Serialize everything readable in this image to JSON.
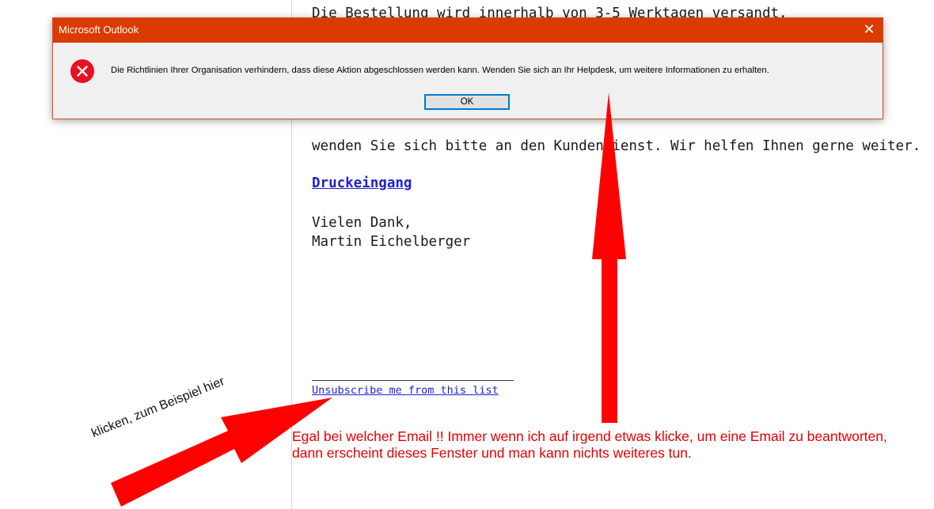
{
  "email": {
    "line_top": "Die Bestellung wird innerhalb von 3-5 Werktagen versandt.",
    "line_contact": "wenden Sie sich bitte an den Kundendienst. Wir helfen Ihnen gerne weiter.",
    "link_label": "Druckeingang",
    "closing": "Vielen Dank,",
    "sender": "Martin Eichelberger",
    "unsubscribe_label": "Unsubscribe me from this list"
  },
  "dialog": {
    "title": "Microsoft Outlook",
    "close_label": "✕",
    "message": "Die Richtlinien Ihrer Organisation verhindern, dass diese Aktion abgeschlossen werden kann. Wenden Sie sich an Ihr Helpdesk, um weitere Informationen zu erhalten.",
    "ok_label": "OK",
    "icon": "error-icon",
    "colors": {
      "titlebar": "#da3b01",
      "error": "#e81123",
      "focus": "#0078d7"
    }
  },
  "annotations": {
    "hint": "klicken, zum Beispiel hier",
    "note": "Egal bei welcher Email !!   Immer wenn ich auf irgend etwas klicke, um eine Email zu beantworten, dann erscheint dieses Fenster und man kann nichts weiteres tun.",
    "arrow_color": "#ff0000"
  }
}
